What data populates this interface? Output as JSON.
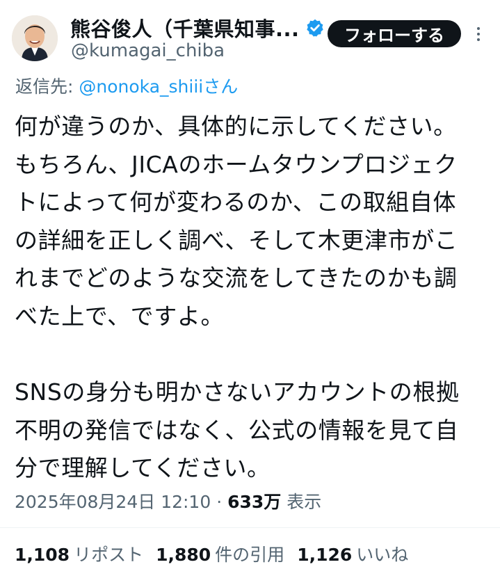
{
  "author": {
    "display_name": "熊谷俊人（千葉県知事...",
    "handle": "@kumagai_chiba",
    "verified_icon": "verified-badge-icon",
    "follow_label": "フォローする",
    "more_icon": "more-vertical-icon"
  },
  "reply": {
    "prefix": "返信先: ",
    "mention": "@nonoka_shiii",
    "suffix": "さん"
  },
  "body": {
    "lines": [
      "何が違うのか、具体的に示してください。",
      "もちろん、JICAのホームタウンプロジェク",
      "トによって何が変わるのか、この取組自体",
      "の詳細を正しく調べ、そして木更津市がこ",
      "れまでどのような交流をしてきたのかも調",
      "べた上で、ですよ。",
      "",
      "SNSの身分も明かさないアカウントの根拠",
      "不明の発信ではなく、公式の情報を見て自",
      "分で理解してください。"
    ]
  },
  "meta": {
    "datetime": "2025年08月24日 12:10",
    "separator": " · ",
    "views_count": "633万",
    "views_label": " 表示"
  },
  "stats": {
    "reposts_count": "1,108",
    "reposts_label": "リポスト",
    "quotes_count": "1,880",
    "quotes_label": "件の引用",
    "likes_count": "1,126",
    "likes_label": "いいね"
  },
  "colors": {
    "text_primary": "#0f1419",
    "text_secondary": "#536471",
    "link": "#1d9bf0",
    "verified": "#1d9bf0",
    "follow_bg": "#0f1419"
  }
}
